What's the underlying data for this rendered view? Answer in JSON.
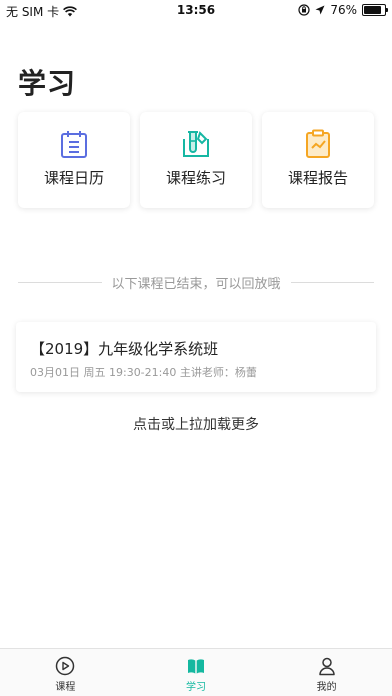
{
  "status_bar": {
    "carrier": "无 SIM 卡",
    "time": "13:56",
    "battery_text": "76%",
    "battery_level": 0.76
  },
  "page_title": "学习",
  "cards": [
    {
      "label": "课程日历",
      "icon": "calendar-icon",
      "color": "#5b6ee0"
    },
    {
      "label": "课程练习",
      "icon": "practice-flask-icon",
      "color": "#16b7a3"
    },
    {
      "label": "课程报告",
      "icon": "report-clipboard-icon",
      "color": "#f5a623"
    }
  ],
  "divider_text": "以下课程已结束，可以回放哦",
  "courses": [
    {
      "title": "【2019】九年级化学系统班",
      "meta": "03月01日 周五 19:30-21:40 主讲老师：杨蕾"
    }
  ],
  "load_more": "点击或上拉加载更多",
  "tabs": [
    {
      "label": "课程",
      "icon": "play-circle-icon",
      "active": false
    },
    {
      "label": "学习",
      "icon": "book-icon",
      "active": true
    },
    {
      "label": "我的",
      "icon": "person-icon",
      "active": false
    }
  ],
  "colors": {
    "accent": "#14b8a0",
    "divider": "#dcdcdc"
  }
}
